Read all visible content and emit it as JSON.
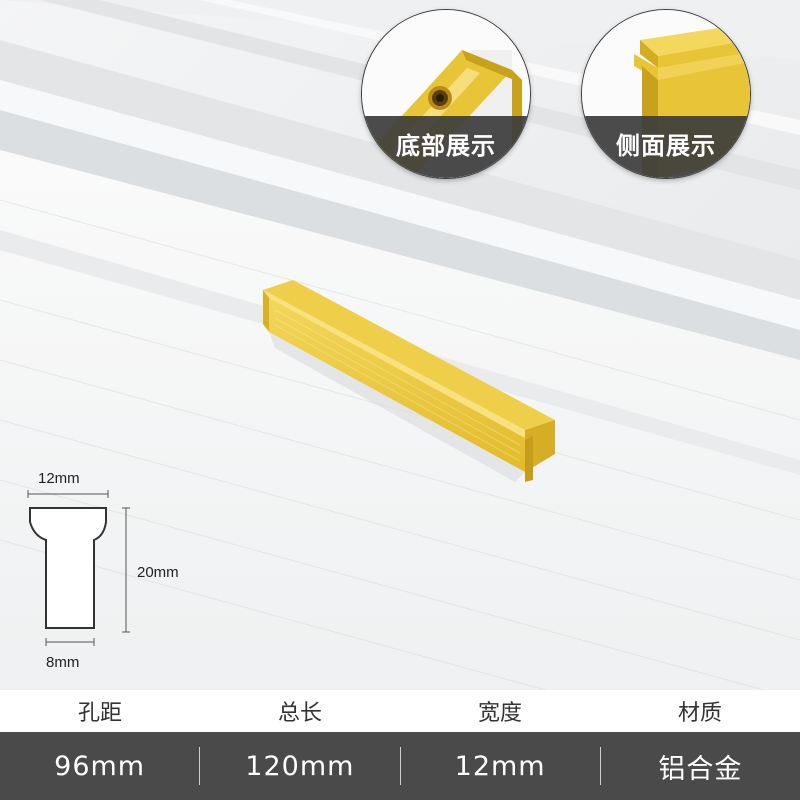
{
  "detail_views": [
    {
      "caption": "底部展示"
    },
    {
      "caption": "侧面展示"
    }
  ],
  "profile": {
    "top_width": "12mm",
    "height": "20mm",
    "bottom_width": "8mm"
  },
  "specs": {
    "headers": [
      "孔距",
      "总长",
      "宽度",
      "材质"
    ],
    "values": [
      "96mm",
      "120mm",
      "12mm",
      "铝合金"
    ]
  },
  "colors": {
    "gold": "#e8c437",
    "gold_light": "#f6df7a",
    "gold_dark": "#c9a21c",
    "table_dark": "#4a4a4a",
    "caption_bg": "#3c3c3c"
  }
}
